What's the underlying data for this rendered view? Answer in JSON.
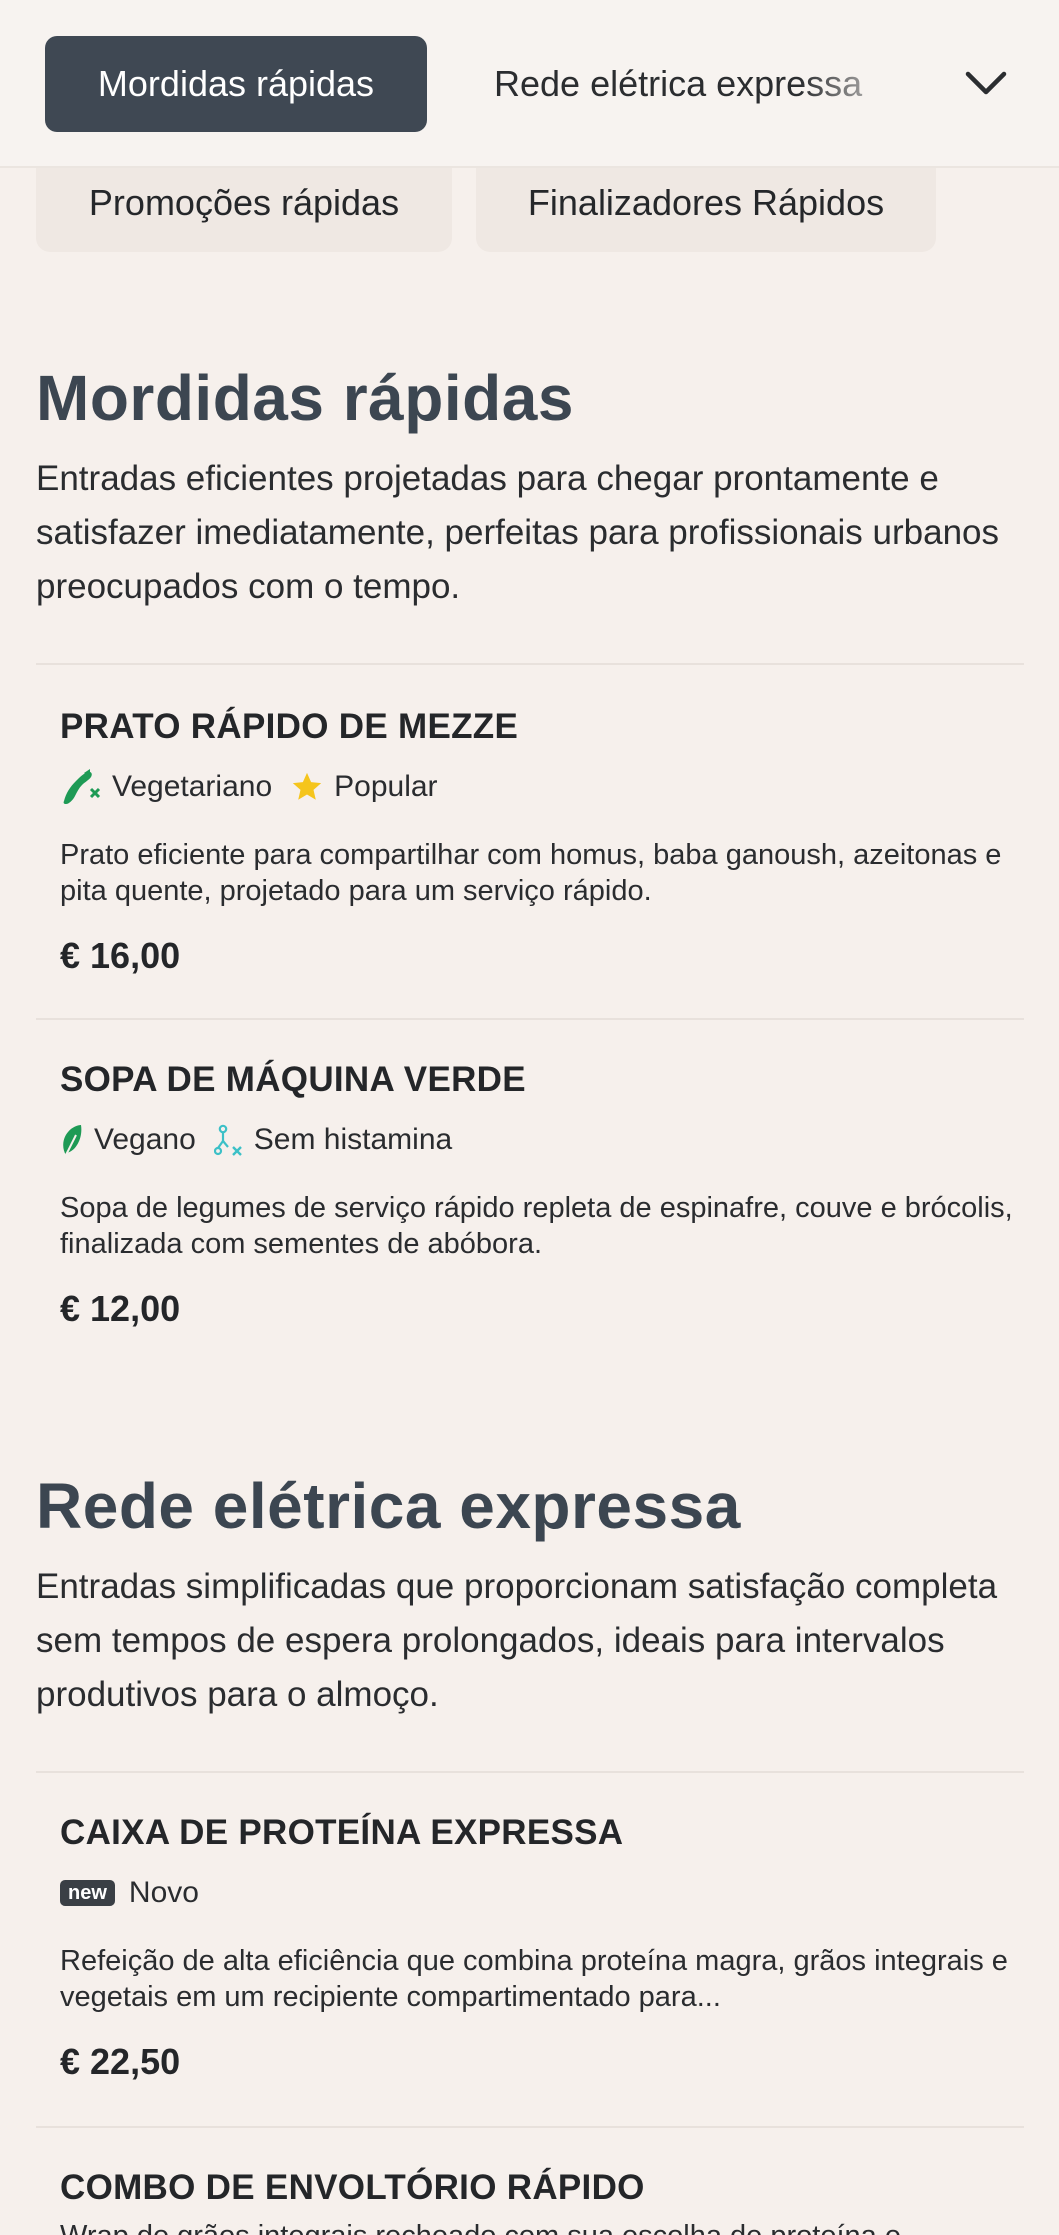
{
  "nav": {
    "active_tab": "Mordidas rápidas",
    "next_tab": "Rede elétrica expressa",
    "more_icon": "chevron-down-icon",
    "sub_tabs": [
      "Promoções rápidas",
      "Finalizadores Rápidos"
    ]
  },
  "colors": {
    "background": "#f6f0ec",
    "active_tab": "#3f4853",
    "heading": "#3c4651",
    "vegetarian": "#1e9a55",
    "vegan": "#1e9a55",
    "popular_star": "#f5c51c",
    "histamine": "#3cc0c7"
  },
  "sections": [
    {
      "title": "Mordidas rápidas",
      "description": "Entradas eficientes projetadas para chegar prontamente e satisfazer imediatamente, perfeitas para profissionais urbanos preocupados com o tempo.",
      "items": [
        {
          "name": "PRATO RÁPIDO DE MEZZE",
          "tags": [
            {
              "icon": "vegetarian-icon",
              "label": "Vegetariano"
            },
            {
              "icon": "star-icon",
              "label": "Popular"
            }
          ],
          "description": "Prato eficiente para compartilhar com homus, baba ganoush, azeitonas e pita quente, projetado para um serviço rápido.",
          "price": "€ 16,00"
        },
        {
          "name": "SOPA DE MÁQUINA VERDE",
          "tags": [
            {
              "icon": "vegan-leaf-icon",
              "label": "Vegano"
            },
            {
              "icon": "histamine-free-icon",
              "label": "Sem histamina"
            }
          ],
          "description": "Sopa de legumes de serviço rápido repleta de espinafre, couve e brócolis, finalizada com sementes de abóbora.",
          "price": "€ 12,00"
        }
      ]
    },
    {
      "title": "Rede elétrica expressa",
      "description": "Entradas simplificadas que proporcionam satisfação completa sem tempos de espera prolongados, ideais para intervalos produtivos para o almoço.",
      "items": [
        {
          "name": "CAIXA DE PROTEÍNA EXPRESSA",
          "badge": "new",
          "tags": [
            {
              "icon": "new-badge",
              "label": "Novo"
            }
          ],
          "description": "Refeição de alta eficiência que combina proteína magra, grãos integrais e vegetais em um recipiente compartimentado para...",
          "price": "€ 22,50"
        },
        {
          "name": "COMBO DE ENVOLTÓRIO RÁPIDO",
          "description": "Wrap de grãos integrais recheado com sua escolha de proteína e"
        }
      ]
    }
  ]
}
